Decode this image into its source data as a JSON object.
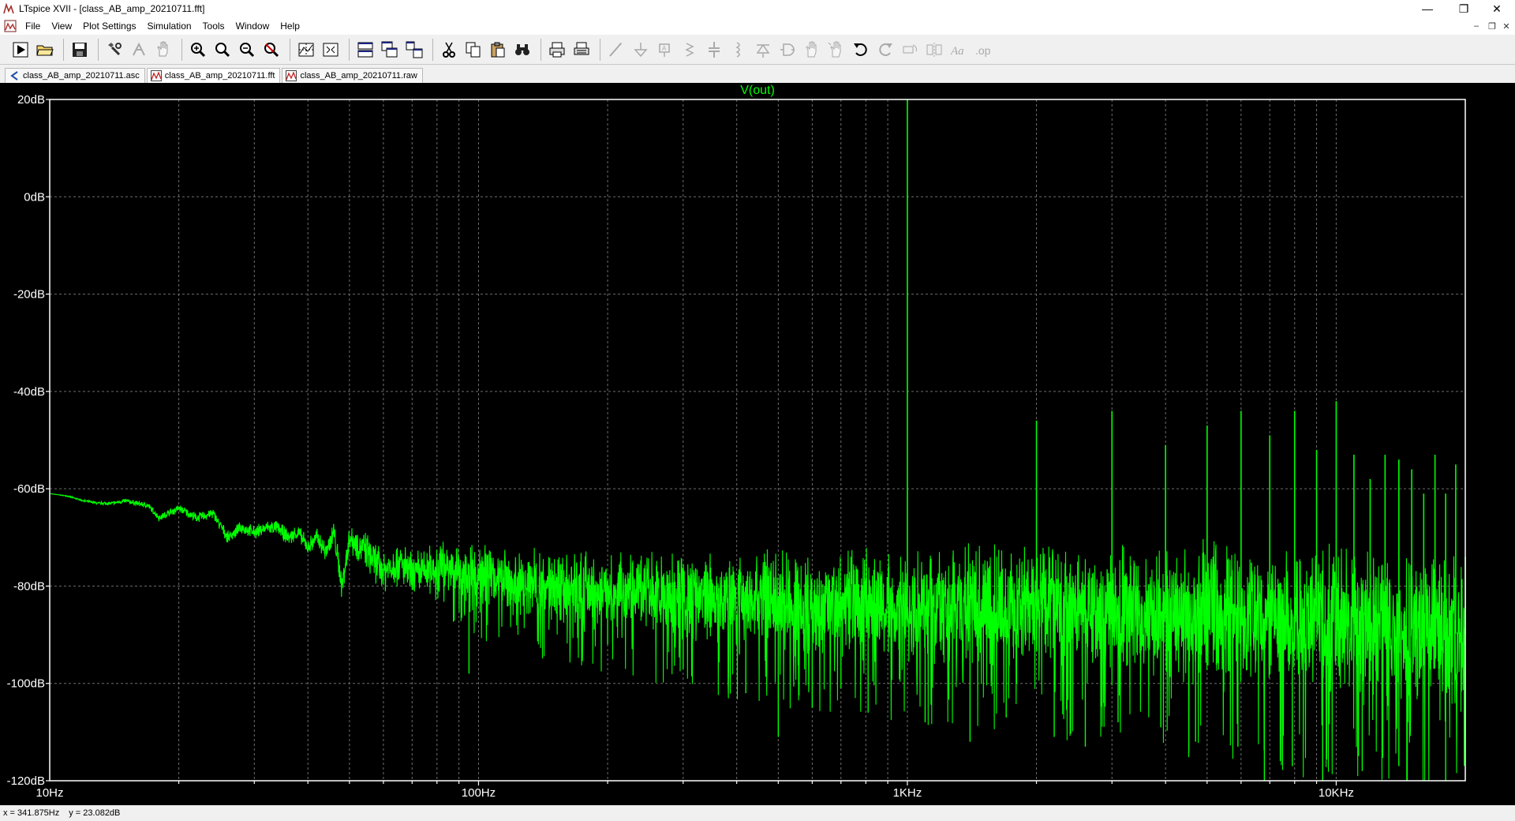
{
  "window": {
    "title": "LTspice XVII - [class_AB_amp_20210711.fft]",
    "controls": {
      "minimize": "—",
      "restore": "❐",
      "close": "✕"
    }
  },
  "menu": {
    "items": [
      "File",
      "View",
      "Plot Settings",
      "Simulation",
      "Tools",
      "Window",
      "Help"
    ],
    "mdi_controls": {
      "minimize": "–",
      "restore": "❐",
      "close": "✕"
    }
  },
  "toolbar": {
    "buttons": [
      {
        "icon": "run-icon"
      },
      {
        "icon": "open-folder-icon"
      },
      {
        "sep": true
      },
      {
        "icon": "save-icon"
      },
      {
        "sep": true
      },
      {
        "icon": "control-panel-icon"
      },
      {
        "icon": "halt-icon",
        "disabled": true
      },
      {
        "icon": "pan-hand-icon",
        "disabled": true
      },
      {
        "sep": true
      },
      {
        "icon": "zoom-in-icon"
      },
      {
        "icon": "zoom-area-icon"
      },
      {
        "icon": "zoom-out-icon"
      },
      {
        "icon": "zoom-fit-icon"
      },
      {
        "sep": true
      },
      {
        "icon": "autorange-icon"
      },
      {
        "icon": "fit-window-icon"
      },
      {
        "sep": true
      },
      {
        "icon": "tile-horizontal-icon"
      },
      {
        "icon": "cascade-icon"
      },
      {
        "icon": "tile-vertical-icon"
      },
      {
        "sep": true
      },
      {
        "icon": "cut-icon"
      },
      {
        "icon": "copy-icon"
      },
      {
        "icon": "paste-icon"
      },
      {
        "icon": "find-icon"
      },
      {
        "sep": true
      },
      {
        "icon": "print-icon"
      },
      {
        "icon": "print-setup-icon"
      },
      {
        "sep": true
      },
      {
        "icon": "wire-icon",
        "disabled": true
      },
      {
        "icon": "ground-icon",
        "disabled": true
      },
      {
        "icon": "label-icon",
        "disabled": true
      },
      {
        "icon": "resistor-icon",
        "disabled": true
      },
      {
        "icon": "capacitor-icon",
        "disabled": true
      },
      {
        "icon": "inductor-icon",
        "disabled": true
      },
      {
        "icon": "diode-icon",
        "disabled": true
      },
      {
        "icon": "component-icon",
        "disabled": true
      },
      {
        "icon": "move-icon",
        "disabled": true
      },
      {
        "icon": "drag-icon",
        "disabled": true
      },
      {
        "icon": "undo-icon"
      },
      {
        "icon": "redo-icon",
        "disabled": true
      },
      {
        "icon": "rotate-icon",
        "disabled": true
      },
      {
        "icon": "mirror-icon",
        "disabled": true
      },
      {
        "icon": "text-icon",
        "disabled": true
      },
      {
        "icon": "spice-directive-icon",
        "disabled": true
      }
    ]
  },
  "tabs": [
    {
      "label": "class_AB_amp_20210711.asc",
      "icon": "schematic-icon",
      "active": false
    },
    {
      "label": "class_AB_amp_20210711.fft",
      "icon": "waveform-icon",
      "active": true
    },
    {
      "label": "class_AB_amp_20210711.raw",
      "icon": "waveform-icon",
      "active": false
    }
  ],
  "status": {
    "x_readout": "x = 341.875Hz",
    "y_readout": "y = 23.082dB"
  },
  "chart_data": {
    "type": "line",
    "trace_name": "V(out)",
    "trace_color": "#00ff00",
    "background": "#000000",
    "grid": true,
    "grid_color": "#6e6e6e",
    "xscale": "log",
    "xlim": [
      10,
      20000
    ],
    "ylim": [
      -120,
      20
    ],
    "xticks": [
      {
        "value": 10,
        "label": "10Hz"
      },
      {
        "value": 100,
        "label": "100Hz"
      },
      {
        "value": 1000,
        "label": "1KHz"
      },
      {
        "value": 10000,
        "label": "10KHz"
      }
    ],
    "yticks": [
      {
        "value": 20,
        "label": "20dB"
      },
      {
        "value": 0,
        "label": "0dB"
      },
      {
        "value": -20,
        "label": "-20dB"
      },
      {
        "value": -40,
        "label": "-40dB"
      },
      {
        "value": -60,
        "label": "-60dB"
      },
      {
        "value": -80,
        "label": "-80dB"
      },
      {
        "value": -100,
        "label": "-100dB"
      },
      {
        "value": -120,
        "label": "-120dB"
      }
    ],
    "baseline": [
      [
        10,
        -61
      ],
      [
        11,
        -61.5
      ],
      [
        12,
        -62.5
      ],
      [
        13,
        -63
      ],
      [
        14,
        -63
      ],
      [
        15,
        -62.5
      ],
      [
        16,
        -63
      ],
      [
        17,
        -63.5
      ],
      [
        18,
        -66
      ],
      [
        20,
        -64
      ],
      [
        22,
        -66
      ],
      [
        24,
        -65
      ],
      [
        26,
        -70
      ],
      [
        28,
        -68
      ],
      [
        30,
        -69
      ],
      [
        32,
        -68
      ],
      [
        34,
        -68
      ],
      [
        36,
        -70
      ],
      [
        38,
        -69
      ],
      [
        40,
        -72
      ],
      [
        42,
        -70
      ],
      [
        44,
        -73
      ],
      [
        46,
        -69
      ],
      [
        48,
        -80
      ],
      [
        50,
        -70
      ],
      [
        55,
        -73
      ],
      [
        60,
        -77
      ],
      [
        65,
        -75
      ],
      [
        70,
        -78
      ],
      [
        80,
        -76
      ],
      [
        90,
        -77
      ],
      [
        100,
        -78
      ],
      [
        150,
        -80
      ],
      [
        200,
        -81
      ],
      [
        300,
        -82
      ],
      [
        500,
        -83
      ],
      [
        700,
        -83.5
      ],
      [
        1000,
        -84
      ],
      [
        2000,
        -84.5
      ],
      [
        3000,
        -85
      ],
      [
        5000,
        -86
      ],
      [
        8000,
        -87
      ],
      [
        12000,
        -88
      ],
      [
        16000,
        -89
      ],
      [
        20000,
        -90
      ]
    ],
    "noise_spread": [
      [
        10,
        0
      ],
      [
        40,
        2
      ],
      [
        60,
        5
      ],
      [
        100,
        7
      ],
      [
        200,
        9
      ],
      [
        400,
        11
      ],
      [
        1000,
        13
      ],
      [
        3000,
        15
      ],
      [
        8000,
        17
      ],
      [
        20000,
        18
      ]
    ],
    "dips": [
      [
        48,
        -80
      ],
      [
        95,
        -98
      ],
      [
        200,
        -92
      ],
      [
        300,
        -97
      ],
      [
        420,
        -102
      ],
      [
        500,
        -111
      ],
      [
        600,
        -105
      ],
      [
        700,
        -101
      ],
      [
        810,
        -106
      ],
      [
        1100,
        -108
      ],
      [
        1400,
        -112
      ],
      [
        1700,
        -107
      ],
      [
        2200,
        -111
      ],
      [
        2600,
        -113
      ],
      [
        3100,
        -108
      ],
      [
        3900,
        -109
      ],
      [
        4700,
        -112
      ],
      [
        5900,
        -113
      ],
      [
        6800,
        -120
      ],
      [
        7900,
        -117
      ],
      [
        9300,
        -120
      ],
      [
        11500,
        -118
      ],
      [
        14000,
        -117
      ],
      [
        18000,
        -120
      ]
    ],
    "harmonics": [
      [
        1000,
        20
      ],
      [
        2000,
        -46
      ],
      [
        3000,
        -44
      ],
      [
        4000,
        -51
      ],
      [
        5000,
        -47
      ],
      [
        6000,
        -44
      ],
      [
        7000,
        -49
      ],
      [
        8000,
        -44
      ],
      [
        9000,
        -52
      ],
      [
        10000,
        -42
      ],
      [
        11000,
        -53
      ],
      [
        12000,
        -58
      ],
      [
        13000,
        -53
      ],
      [
        14000,
        -54
      ],
      [
        15000,
        -56
      ],
      [
        16000,
        -61
      ],
      [
        17000,
        -53
      ],
      [
        18000,
        -61
      ],
      [
        19000,
        -55
      ],
      [
        20000,
        -74
      ]
    ]
  }
}
